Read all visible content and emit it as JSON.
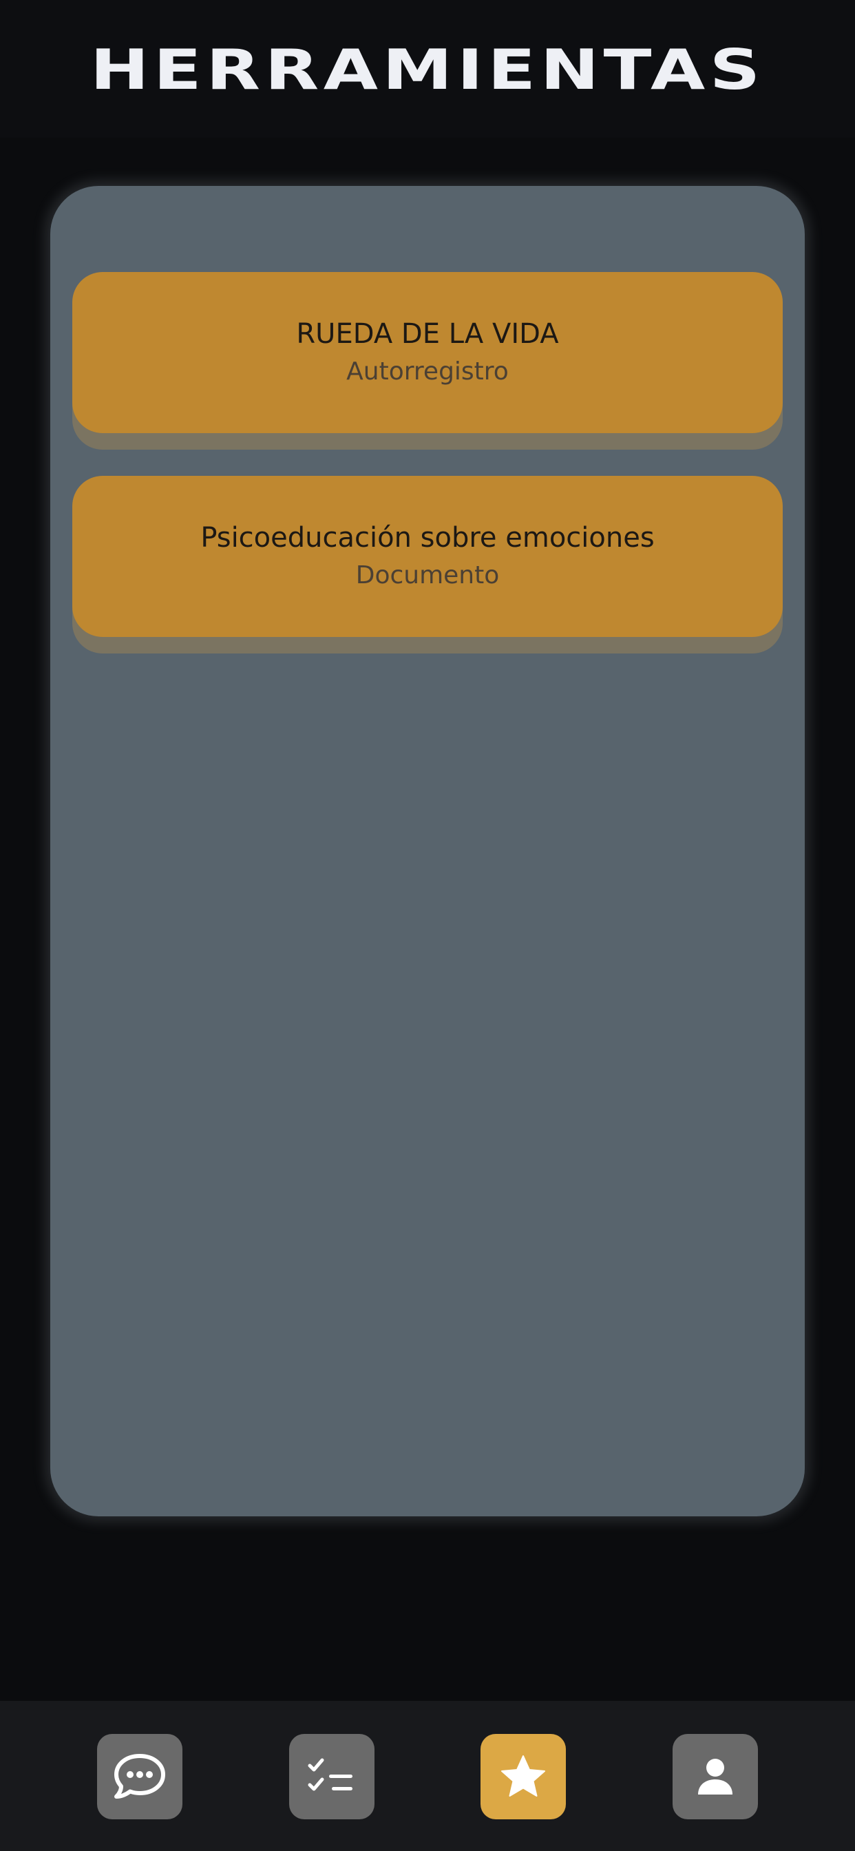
{
  "header": {
    "title": "HERRAMIENTAS"
  },
  "tools": [
    {
      "title": "RUEDA DE LA VIDA",
      "type": "Autorregistro"
    },
    {
      "title": "Psicoeducación sobre emociones",
      "type": "Documento"
    }
  ],
  "bottom_nav": {
    "items": [
      {
        "icon": "chat-bubble-icon",
        "active": false
      },
      {
        "icon": "checklist-icon",
        "active": false
      },
      {
        "icon": "star-icon",
        "active": true
      },
      {
        "icon": "user-icon",
        "active": false
      }
    ]
  },
  "colors": {
    "background": "#0b0c0e",
    "panel": "#58646d",
    "card": "#bf8830",
    "nav_active": "#dca845",
    "nav_inactive": "#6a6a6a"
  }
}
